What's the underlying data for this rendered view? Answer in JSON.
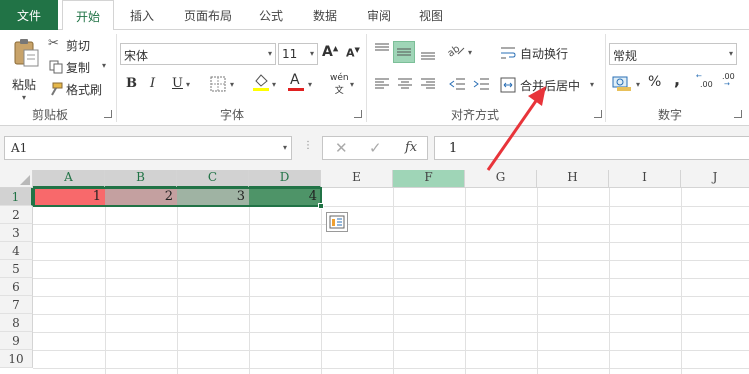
{
  "tabs": {
    "file": "文件",
    "home": "开始",
    "insert": "插入",
    "page_layout": "页面布局",
    "formula": "公式",
    "data": "数据",
    "review": "审阅",
    "view": "视图"
  },
  "clipboard": {
    "paste": "粘贴",
    "cut": "剪切",
    "copy": "复制",
    "format_painter": "格式刷",
    "group_label": "剪贴板"
  },
  "font": {
    "name": "宋体",
    "size": "11",
    "bold": "B",
    "italic": "I",
    "underline": "U",
    "grow": "A",
    "shrink": "A",
    "font_color_letter": "A",
    "phonetic": "wén",
    "group_label": "字体"
  },
  "alignment": {
    "wrap_text": "自动换行",
    "merge_center": "合并后居中",
    "group_label": "对齐方式"
  },
  "number": {
    "format": "常规",
    "percent": "%",
    "comma": ",",
    "inc_decimal": ".00",
    "dec_decimal": ".00",
    "group_label": "数字"
  },
  "formula_bar": {
    "name_box": "A1",
    "fx": "fx",
    "value": "1"
  },
  "columns": [
    "A",
    "B",
    "C",
    "D",
    "E",
    "F",
    "G",
    "H",
    "I",
    "J"
  ],
  "rows": [
    "1",
    "2",
    "3",
    "4",
    "5",
    "6",
    "7",
    "8",
    "9",
    "10"
  ],
  "cells": {
    "a1": "1",
    "b1": "2",
    "c1": "3",
    "d1": "4"
  },
  "colors": {
    "brand": "#217346",
    "a1_fill": "#f8696b",
    "b1_fill": "#c4a0a0",
    "c1_fill": "#9fb3a3",
    "d1_fill": "#4e9468",
    "arrow": "#e8343a"
  }
}
